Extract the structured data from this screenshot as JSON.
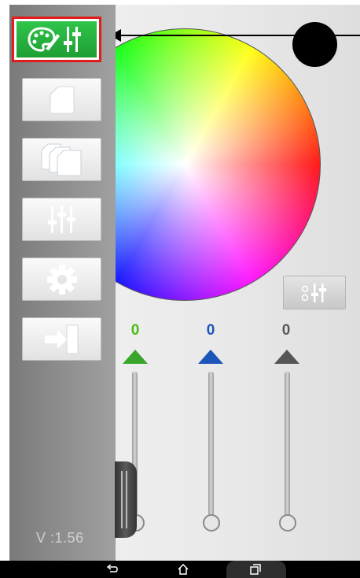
{
  "app": {
    "version_label": "V :1.56"
  },
  "sidebar": {
    "items": [
      {
        "icon": "palette-sliders-icon",
        "active": true
      },
      {
        "icon": "single-page-icon"
      },
      {
        "icon": "multiple-pages-icon"
      },
      {
        "icon": "sliders-icon"
      },
      {
        "icon": "gear-icon"
      },
      {
        "icon": "exit-door-icon"
      }
    ]
  },
  "color_picker": {
    "preview_color": "#000000",
    "mode_button_icon": "rgb-sliders-icon"
  },
  "channels": [
    {
      "value": "0",
      "color": "#4cbb17",
      "slider_level": 0
    },
    {
      "value": "0",
      "color": "#1c56b8",
      "slider_level": 0
    },
    {
      "value": "0",
      "color": "#5a5a5a",
      "slider_level": 0
    }
  ],
  "navbar": {
    "buttons": [
      "back-icon",
      "home-icon",
      "recents-icon"
    ]
  },
  "colors": {
    "highlight_border": "#e01d1d",
    "active_button": "#2aae44"
  }
}
